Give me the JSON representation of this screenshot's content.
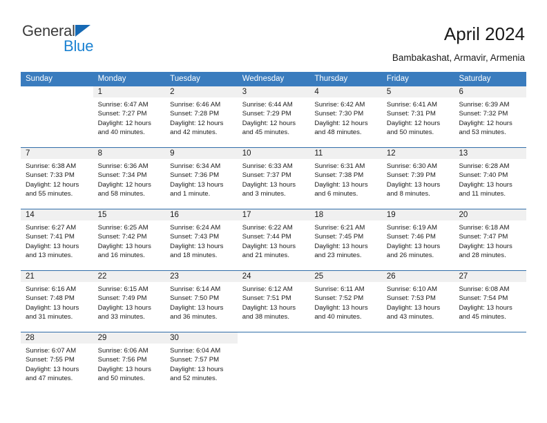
{
  "brand": {
    "name_part1": "General",
    "name_part2": "Blue",
    "triangle_color": "#1669b4",
    "blue_color": "#1b82d2"
  },
  "header": {
    "title": "April 2024",
    "subtitle": "Bambakashat, Armavir, Armenia"
  },
  "theme": {
    "header_blue": "#3a7cbe",
    "separator_blue": "#2f6ca8",
    "daynum_band": "#f0f0f0",
    "text": "#1a1a1a"
  },
  "weekdays": [
    "Sunday",
    "Monday",
    "Tuesday",
    "Wednesday",
    "Thursday",
    "Friday",
    "Saturday"
  ],
  "weeks": [
    [
      {
        "day": "",
        "lines": []
      },
      {
        "day": "1",
        "lines": [
          "Sunrise: 6:47 AM",
          "Sunset: 7:27 PM",
          "Daylight: 12 hours",
          "and 40 minutes."
        ]
      },
      {
        "day": "2",
        "lines": [
          "Sunrise: 6:46 AM",
          "Sunset: 7:28 PM",
          "Daylight: 12 hours",
          "and 42 minutes."
        ]
      },
      {
        "day": "3",
        "lines": [
          "Sunrise: 6:44 AM",
          "Sunset: 7:29 PM",
          "Daylight: 12 hours",
          "and 45 minutes."
        ]
      },
      {
        "day": "4",
        "lines": [
          "Sunrise: 6:42 AM",
          "Sunset: 7:30 PM",
          "Daylight: 12 hours",
          "and 48 minutes."
        ]
      },
      {
        "day": "5",
        "lines": [
          "Sunrise: 6:41 AM",
          "Sunset: 7:31 PM",
          "Daylight: 12 hours",
          "and 50 minutes."
        ]
      },
      {
        "day": "6",
        "lines": [
          "Sunrise: 6:39 AM",
          "Sunset: 7:32 PM",
          "Daylight: 12 hours",
          "and 53 minutes."
        ]
      }
    ],
    [
      {
        "day": "7",
        "lines": [
          "Sunrise: 6:38 AM",
          "Sunset: 7:33 PM",
          "Daylight: 12 hours",
          "and 55 minutes."
        ]
      },
      {
        "day": "8",
        "lines": [
          "Sunrise: 6:36 AM",
          "Sunset: 7:34 PM",
          "Daylight: 12 hours",
          "and 58 minutes."
        ]
      },
      {
        "day": "9",
        "lines": [
          "Sunrise: 6:34 AM",
          "Sunset: 7:36 PM",
          "Daylight: 13 hours",
          "and 1 minute."
        ]
      },
      {
        "day": "10",
        "lines": [
          "Sunrise: 6:33 AM",
          "Sunset: 7:37 PM",
          "Daylight: 13 hours",
          "and 3 minutes."
        ]
      },
      {
        "day": "11",
        "lines": [
          "Sunrise: 6:31 AM",
          "Sunset: 7:38 PM",
          "Daylight: 13 hours",
          "and 6 minutes."
        ]
      },
      {
        "day": "12",
        "lines": [
          "Sunrise: 6:30 AM",
          "Sunset: 7:39 PM",
          "Daylight: 13 hours",
          "and 8 minutes."
        ]
      },
      {
        "day": "13",
        "lines": [
          "Sunrise: 6:28 AM",
          "Sunset: 7:40 PM",
          "Daylight: 13 hours",
          "and 11 minutes."
        ]
      }
    ],
    [
      {
        "day": "14",
        "lines": [
          "Sunrise: 6:27 AM",
          "Sunset: 7:41 PM",
          "Daylight: 13 hours",
          "and 13 minutes."
        ]
      },
      {
        "day": "15",
        "lines": [
          "Sunrise: 6:25 AM",
          "Sunset: 7:42 PM",
          "Daylight: 13 hours",
          "and 16 minutes."
        ]
      },
      {
        "day": "16",
        "lines": [
          "Sunrise: 6:24 AM",
          "Sunset: 7:43 PM",
          "Daylight: 13 hours",
          "and 18 minutes."
        ]
      },
      {
        "day": "17",
        "lines": [
          "Sunrise: 6:22 AM",
          "Sunset: 7:44 PM",
          "Daylight: 13 hours",
          "and 21 minutes."
        ]
      },
      {
        "day": "18",
        "lines": [
          "Sunrise: 6:21 AM",
          "Sunset: 7:45 PM",
          "Daylight: 13 hours",
          "and 23 minutes."
        ]
      },
      {
        "day": "19",
        "lines": [
          "Sunrise: 6:19 AM",
          "Sunset: 7:46 PM",
          "Daylight: 13 hours",
          "and 26 minutes."
        ]
      },
      {
        "day": "20",
        "lines": [
          "Sunrise: 6:18 AM",
          "Sunset: 7:47 PM",
          "Daylight: 13 hours",
          "and 28 minutes."
        ]
      }
    ],
    [
      {
        "day": "21",
        "lines": [
          "Sunrise: 6:16 AM",
          "Sunset: 7:48 PM",
          "Daylight: 13 hours",
          "and 31 minutes."
        ]
      },
      {
        "day": "22",
        "lines": [
          "Sunrise: 6:15 AM",
          "Sunset: 7:49 PM",
          "Daylight: 13 hours",
          "and 33 minutes."
        ]
      },
      {
        "day": "23",
        "lines": [
          "Sunrise: 6:14 AM",
          "Sunset: 7:50 PM",
          "Daylight: 13 hours",
          "and 36 minutes."
        ]
      },
      {
        "day": "24",
        "lines": [
          "Sunrise: 6:12 AM",
          "Sunset: 7:51 PM",
          "Daylight: 13 hours",
          "and 38 minutes."
        ]
      },
      {
        "day": "25",
        "lines": [
          "Sunrise: 6:11 AM",
          "Sunset: 7:52 PM",
          "Daylight: 13 hours",
          "and 40 minutes."
        ]
      },
      {
        "day": "26",
        "lines": [
          "Sunrise: 6:10 AM",
          "Sunset: 7:53 PM",
          "Daylight: 13 hours",
          "and 43 minutes."
        ]
      },
      {
        "day": "27",
        "lines": [
          "Sunrise: 6:08 AM",
          "Sunset: 7:54 PM",
          "Daylight: 13 hours",
          "and 45 minutes."
        ]
      }
    ],
    [
      {
        "day": "28",
        "lines": [
          "Sunrise: 6:07 AM",
          "Sunset: 7:55 PM",
          "Daylight: 13 hours",
          "and 47 minutes."
        ]
      },
      {
        "day": "29",
        "lines": [
          "Sunrise: 6:06 AM",
          "Sunset: 7:56 PM",
          "Daylight: 13 hours",
          "and 50 minutes."
        ]
      },
      {
        "day": "30",
        "lines": [
          "Sunrise: 6:04 AM",
          "Sunset: 7:57 PM",
          "Daylight: 13 hours",
          "and 52 minutes."
        ]
      },
      {
        "day": "",
        "lines": []
      },
      {
        "day": "",
        "lines": []
      },
      {
        "day": "",
        "lines": []
      },
      {
        "day": "",
        "lines": []
      }
    ]
  ]
}
